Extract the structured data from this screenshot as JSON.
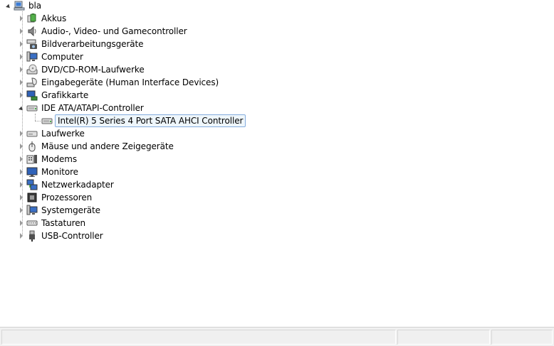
{
  "tree": {
    "root": {
      "label": "bla",
      "icon": "computer-root-icon",
      "expanded": true
    },
    "categories": [
      {
        "label": "Akkus",
        "icon": "battery-icon",
        "expanded": false
      },
      {
        "label": "Audio-, Video- und Gamecontroller",
        "icon": "speaker-icon",
        "expanded": false
      },
      {
        "label": "Bildverarbeitungsgeräte",
        "icon": "camera-scanner-icon",
        "expanded": false
      },
      {
        "label": "Computer",
        "icon": "monitor-pc-icon",
        "expanded": false
      },
      {
        "label": "DVD/CD-ROM-Laufwerke",
        "icon": "optical-drive-icon",
        "expanded": false
      },
      {
        "label": "Eingabegeräte (Human Interface Devices)",
        "icon": "hid-icon",
        "expanded": false
      },
      {
        "label": "Grafikkarte",
        "icon": "display-adapter-icon",
        "expanded": false
      },
      {
        "label": "IDE ATA/ATAPI-Controller",
        "icon": "ide-controller-icon",
        "expanded": true,
        "children": [
          {
            "label": "Intel(R) 5 Series 4 Port SATA AHCI Controller",
            "icon": "ide-controller-icon",
            "selected": true
          }
        ]
      },
      {
        "label": "Laufwerke",
        "icon": "disk-drive-icon",
        "expanded": false
      },
      {
        "label": "Mäuse und andere Zeigegeräte",
        "icon": "mouse-icon",
        "expanded": false
      },
      {
        "label": "Modems",
        "icon": "modem-icon",
        "expanded": false
      },
      {
        "label": "Monitore",
        "icon": "monitor-icon",
        "expanded": false
      },
      {
        "label": "Netzwerkadapter",
        "icon": "network-adapter-icon",
        "expanded": false
      },
      {
        "label": "Prozessoren",
        "icon": "processor-icon",
        "expanded": false
      },
      {
        "label": "Systemgeräte",
        "icon": "system-device-icon",
        "expanded": false
      },
      {
        "label": "Tastaturen",
        "icon": "keyboard-icon",
        "expanded": false
      },
      {
        "label": "USB-Controller",
        "icon": "usb-icon",
        "expanded": false
      }
    ]
  },
  "colors": {
    "selection_fill": "#eef6fb",
    "selection_border": "#84acdd",
    "statusbar": "#f0f0f0"
  }
}
